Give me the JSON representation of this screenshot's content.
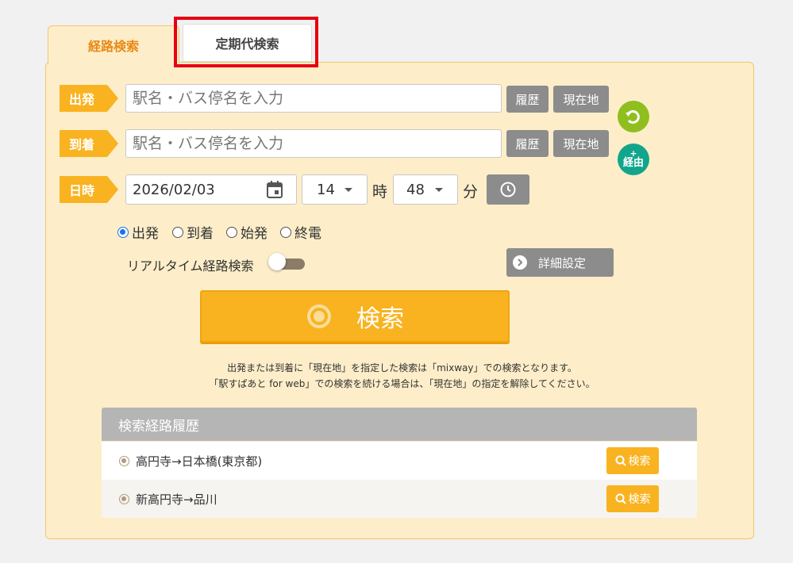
{
  "tabs": {
    "route": "経路検索",
    "pass": "定期代検索"
  },
  "departure": {
    "label": "出発",
    "placeholder": "駅名・バス停名を入力",
    "history": "履歴",
    "current": "現在地"
  },
  "arrival": {
    "label": "到着",
    "placeholder": "駅名・バス停名を入力",
    "history": "履歴",
    "current": "現在地"
  },
  "via_label": "経由",
  "via_plus": "+",
  "datetime": {
    "label": "日時",
    "date": "2026/02/03",
    "hour": "14",
    "hour_unit": "時",
    "minute": "48",
    "minute_unit": "分"
  },
  "time_type": {
    "selected": "出発",
    "options": [
      "出発",
      "到着",
      "始発",
      "終電"
    ]
  },
  "realtime": {
    "label": "リアルタイム経路検索",
    "enabled": false
  },
  "detail_button": "詳細設定",
  "search_button": "検索",
  "notes": [
    "出発または到着に「現在地」を指定した検索は「mixway」での検索となります。",
    "「駅すぱあと for web」での検索を続ける場合は、「現在地」の指定を解除してください。"
  ],
  "history": {
    "title": "検索経路履歴",
    "items": [
      {
        "route": "高円寺→日本橋(東京都)",
        "button": "検索"
      },
      {
        "route": "新高円寺→品川",
        "button": "検索"
      }
    ]
  },
  "colors": {
    "accent": "#f9b320",
    "panel": "#fdeec9",
    "highlight": "#e60012",
    "swap": "#8fbf1f",
    "via": "#12a58c"
  },
  "icons": [
    "calendar-icon",
    "chevron-down-icon",
    "clock-icon",
    "swap-icon",
    "chevron-right-icon",
    "search-icon"
  ]
}
